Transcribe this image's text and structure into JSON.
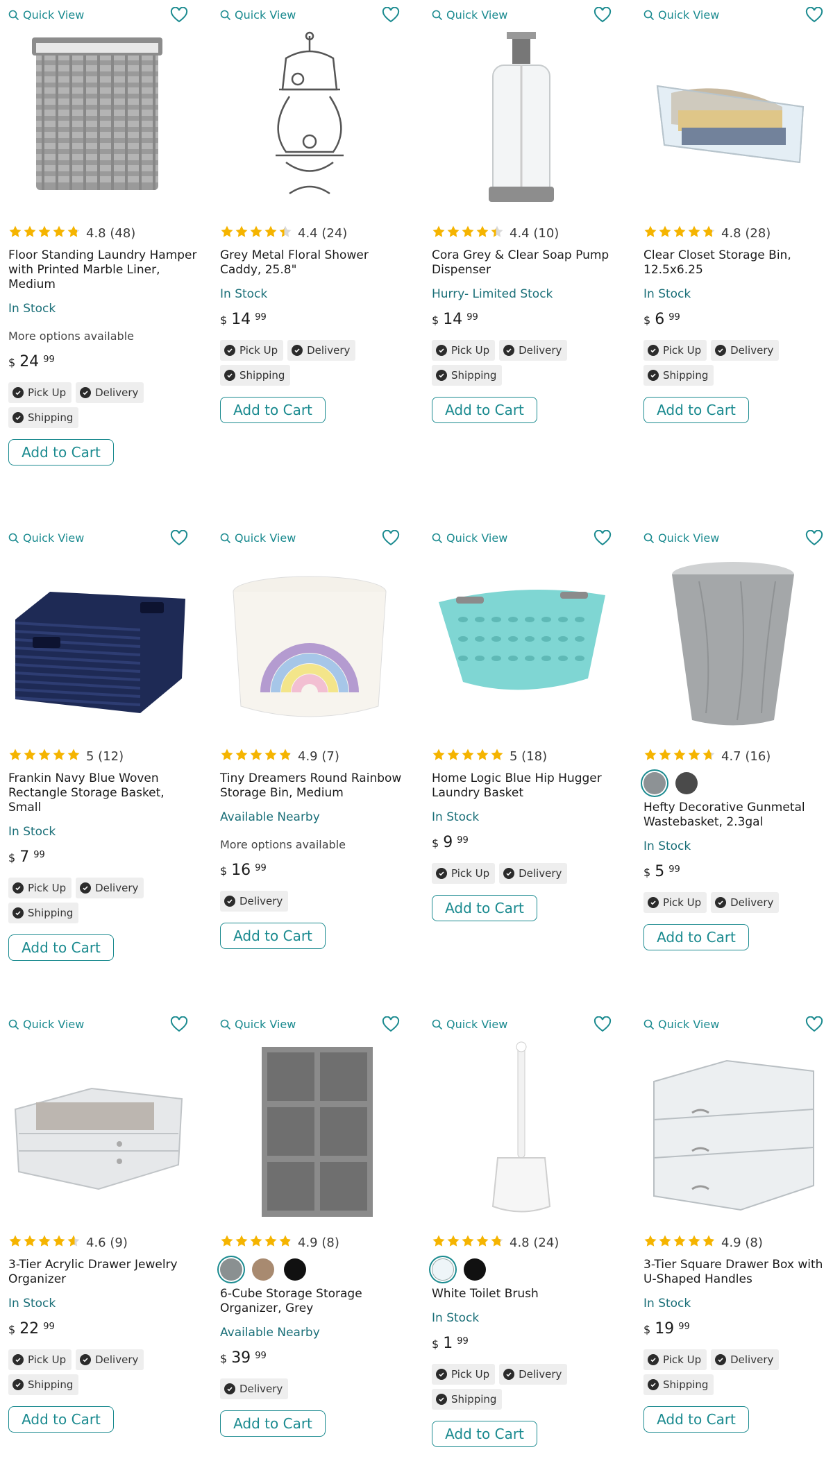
{
  "quick_view_label": "Quick View",
  "add_to_cart_label": "Add to Cart",
  "currency": "$",
  "colors": {
    "accent": "#1a8a8f",
    "star": "#f5b400",
    "stock_text": "#1a6f78"
  },
  "products": [
    {
      "title": "Floor Standing Laundry Hamper with Printed Marble Liner, Medium",
      "rating": 4.8,
      "rating_text": "4.8 (48)",
      "stock": "In Stock",
      "more_options": "More options available",
      "price_dollars": "24",
      "price_cents": "99",
      "fulfillment": [
        "Pick Up",
        "Delivery",
        "Shipping"
      ],
      "image": "wicker-hamper",
      "swatches": []
    },
    {
      "title": "Grey Metal Floral Shower Caddy, 25.8\"",
      "rating": 4.4,
      "rating_text": "4.4 (24)",
      "stock": "In Stock",
      "price_dollars": "14",
      "price_cents": "99",
      "fulfillment": [
        "Pick Up",
        "Delivery",
        "Shipping"
      ],
      "image": "shower-caddy",
      "swatches": []
    },
    {
      "title": "Cora Grey & Clear Soap Pump Dispenser",
      "rating": 4.4,
      "rating_text": "4.4 (10)",
      "stock": "Hurry- Limited Stock",
      "price_dollars": "14",
      "price_cents": "99",
      "fulfillment": [
        "Pick Up",
        "Delivery",
        "Shipping"
      ],
      "image": "soap-pump",
      "swatches": []
    },
    {
      "title": "Clear Closet Storage Bin, 12.5x6.25",
      "rating": 4.8,
      "rating_text": "4.8 (28)",
      "stock": "In Stock",
      "price_dollars": "6",
      "price_cents": "99",
      "fulfillment": [
        "Pick Up",
        "Delivery",
        "Shipping"
      ],
      "image": "clear-bin",
      "swatches": []
    },
    {
      "title": "Frankin Navy Blue Woven Rectangle Storage Basket, Small",
      "rating": 5,
      "rating_text": "5 (12)",
      "stock": "In Stock",
      "price_dollars": "7",
      "price_cents": "99",
      "fulfillment": [
        "Pick Up",
        "Delivery",
        "Shipping"
      ],
      "image": "navy-basket",
      "swatches": []
    },
    {
      "title": "Tiny Dreamers Round Rainbow Storage Bin, Medium",
      "rating": 4.9,
      "rating_text": "4.9 (7)",
      "stock": "Available Nearby",
      "more_options": "More options available",
      "price_dollars": "16",
      "price_cents": "99",
      "fulfillment": [
        "Delivery"
      ],
      "image": "rainbow-bin",
      "swatches": []
    },
    {
      "title": "Home Logic Blue Hip Hugger Laundry Basket",
      "rating": 5,
      "rating_text": "5 (18)",
      "stock": "In Stock",
      "price_dollars": "9",
      "price_cents": "99",
      "fulfillment": [
        "Pick Up",
        "Delivery"
      ],
      "image": "laundry-basket",
      "swatches": []
    },
    {
      "title": "Hefty Decorative Gunmetal Wastebasket, 2.3gal",
      "rating": 4.7,
      "rating_text": "4.7 (16)",
      "stock": "In Stock",
      "price_dollars": "5",
      "price_cents": "99",
      "fulfillment": [
        "Pick Up",
        "Delivery"
      ],
      "image": "wastebasket",
      "swatches": [
        "#8d9295",
        "#4a4a4a"
      ]
    },
    {
      "title": "3-Tier Acrylic Drawer Jewelry Organizer",
      "rating": 4.6,
      "rating_text": "4.6 (9)",
      "stock": "In Stock",
      "price_dollars": "22",
      "price_cents": "99",
      "fulfillment": [
        "Pick Up",
        "Delivery",
        "Shipping"
      ],
      "image": "jewelry-organizer",
      "swatches": []
    },
    {
      "title": "6-Cube Storage Storage Organizer, Grey",
      "rating": 4.9,
      "rating_text": "4.9 (8)",
      "stock": "Available Nearby",
      "price_dollars": "39",
      "price_cents": "99",
      "fulfillment": [
        "Delivery"
      ],
      "image": "cube-organizer",
      "swatches": [
        "#8a9091",
        "#a88a70",
        "#111111"
      ]
    },
    {
      "title": "White Toilet Brush",
      "rating": 4.8,
      "rating_text": "4.8 (24)",
      "stock": "In Stock",
      "price_dollars": "1",
      "price_cents": "99",
      "fulfillment": [
        "Pick Up",
        "Delivery",
        "Shipping"
      ],
      "image": "toilet-brush",
      "swatches": [
        "#eef5f8",
        "#111111"
      ]
    },
    {
      "title": "3-Tier Square Drawer Box with U-Shaped Handles",
      "rating": 4.9,
      "rating_text": "4.9 (8)",
      "stock": "In Stock",
      "price_dollars": "19",
      "price_cents": "99",
      "fulfillment": [
        "Pick Up",
        "Delivery",
        "Shipping"
      ],
      "image": "drawer-box",
      "swatches": []
    }
  ]
}
